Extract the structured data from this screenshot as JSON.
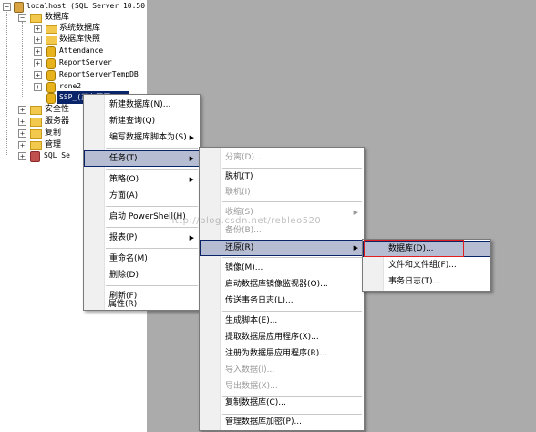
{
  "tree": {
    "server": "localhost (SQL Server 10.50",
    "databases": "数据库",
    "system_databases": "系统数据库",
    "db_snapshots": "数据库快照",
    "dbs": [
      "Attendance",
      "ReportServer",
      "ReportServerTempDB",
      "rone2"
    ],
    "selected_db": "SSP_(正在还原...)",
    "security": "安全性",
    "server_objects": "服务器",
    "replication": "复制",
    "management": "管理",
    "agent": "SQL Se"
  },
  "menu1": [
    "新建数据库(N)...",
    "新建查询(Q)",
    "编写数据库脚本为(S)",
    "任务(T)",
    "策略(O)",
    "方面(A)",
    "启动 PowerShell(H)",
    "报表(P)",
    "重命名(M)",
    "删除(D)",
    "刷新(F)",
    "属性(R)"
  ],
  "menu2": [
    "分离(D)...",
    "脱机(T)",
    "联机(I)",
    "收缩(S)",
    "备份(B)...",
    "还原(R)",
    "镜像(M)...",
    "启动数据库镜像监视器(O)...",
    "传送事务日志(L)...",
    "生成脚本(E)...",
    "提取数据层应用程序(X)...",
    "注册为数据层应用程序(R)...",
    "导入数据(I)...",
    "导出数据(X)...",
    "复制数据库(C)...",
    "管理数据库加密(P)..."
  ],
  "menu3": [
    "数据库(D)...",
    "文件和文件组(F)...",
    "事务日志(T)..."
  ],
  "watermark": "http://blog.csdn.net/rebleo520",
  "colors": {
    "highlight": "#b6bdd2",
    "desktop": "#ababab",
    "red_box": "#e02020"
  }
}
